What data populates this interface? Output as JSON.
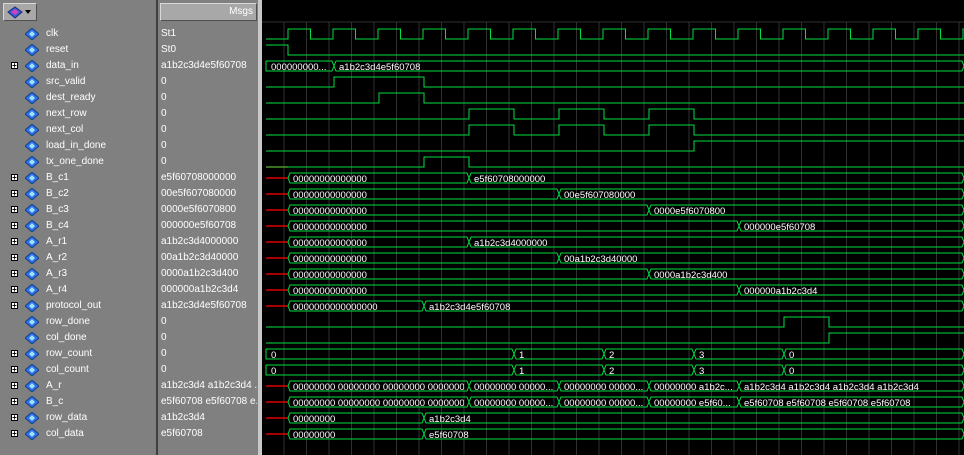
{
  "toolbar": {
    "icon": "signal-wave-icon",
    "dropdown_icon": "chevron-down-icon"
  },
  "header": {
    "msgs_label": "Msgs"
  },
  "colors": {
    "wave": "#00e040",
    "uninit": "#e00000",
    "grid": "#303030",
    "bg": "#000000",
    "panel": "#808080"
  },
  "signals": [
    {
      "name": "clk",
      "value": "St1",
      "expandable": false,
      "kind": "bit"
    },
    {
      "name": "reset",
      "value": "St0",
      "expandable": false,
      "kind": "bit"
    },
    {
      "name": "data_in",
      "value": "a1b2c3d4e5f60708",
      "expandable": true,
      "kind": "bus"
    },
    {
      "name": "src_valid",
      "value": "0",
      "expandable": false,
      "kind": "bit"
    },
    {
      "name": "dest_ready",
      "value": "0",
      "expandable": false,
      "kind": "bit"
    },
    {
      "name": "next_row",
      "value": "0",
      "expandable": false,
      "kind": "bit"
    },
    {
      "name": "next_col",
      "value": "0",
      "expandable": false,
      "kind": "bit"
    },
    {
      "name": "load_in_done",
      "value": "0",
      "expandable": false,
      "kind": "bit"
    },
    {
      "name": "tx_one_done",
      "value": "0",
      "expandable": false,
      "kind": "bit"
    },
    {
      "name": "B_c1",
      "value": "e5f60708000000",
      "expandable": true,
      "kind": "bus"
    },
    {
      "name": "B_c2",
      "value": "00e5f607080000",
      "expandable": true,
      "kind": "bus"
    },
    {
      "name": "B_c3",
      "value": "0000e5f6070800",
      "expandable": true,
      "kind": "bus"
    },
    {
      "name": "B_c4",
      "value": "000000e5f60708",
      "expandable": true,
      "kind": "bus"
    },
    {
      "name": "A_r1",
      "value": "a1b2c3d4000000",
      "expandable": true,
      "kind": "bus"
    },
    {
      "name": "A_r2",
      "value": "00a1b2c3d40000",
      "expandable": true,
      "kind": "bus"
    },
    {
      "name": "A_r3",
      "value": "0000a1b2c3d400",
      "expandable": true,
      "kind": "bus"
    },
    {
      "name": "A_r4",
      "value": "000000a1b2c3d4",
      "expandable": true,
      "kind": "bus"
    },
    {
      "name": "protocol_out",
      "value": "a1b2c3d4e5f60708",
      "expandable": true,
      "kind": "bus"
    },
    {
      "name": "row_done",
      "value": "0",
      "expandable": false,
      "kind": "bit"
    },
    {
      "name": "col_done",
      "value": "0",
      "expandable": false,
      "kind": "bit"
    },
    {
      "name": "row_count",
      "value": "0",
      "expandable": true,
      "kind": "bus"
    },
    {
      "name": "col_count",
      "value": "0",
      "expandable": true,
      "kind": "bus"
    },
    {
      "name": "A_r",
      "value": "a1b2c3d4 a1b2c3d4 ...",
      "expandable": true,
      "kind": "bus"
    },
    {
      "name": "B_c",
      "value": "e5f60708 e5f60708 e...",
      "expandable": true,
      "kind": "bus"
    },
    {
      "name": "row_data",
      "value": "a1b2c3d4",
      "expandable": true,
      "kind": "bus"
    },
    {
      "name": "col_data",
      "value": "e5f60708",
      "expandable": true,
      "kind": "bus"
    }
  ],
  "waves": {
    "clk": {
      "type": "clock"
    },
    "reset": {
      "type": "bit",
      "initial": 1,
      "edges": [
        22
      ],
      "red_until": 0
    },
    "data_in": {
      "type": "bus",
      "red_until": 0,
      "segments": [
        {
          "start": 0,
          "label": "000000000..."
        },
        {
          "start": 68,
          "label": "a1b2c3d4e5f60708"
        }
      ]
    },
    "src_valid": {
      "type": "bit",
      "initial": 0,
      "edges": [
        68,
        158
      ],
      "red_until": 0
    },
    "dest_ready": {
      "type": "bit",
      "initial": 0,
      "edges": [
        113,
        158
      ],
      "red_until": 0
    },
    "next_row": {
      "type": "bit",
      "initial": 0,
      "edges": [
        203,
        248,
        293,
        338,
        383,
        428
      ],
      "red_until": 0
    },
    "next_col": {
      "type": "bit",
      "initial": 0,
      "edges": [
        203,
        248,
        293,
        338,
        383,
        428
      ],
      "red_until": 0
    },
    "load_in_done": {
      "type": "bit",
      "initial": 0,
      "edges": [
        428
      ],
      "red_until": 0
    },
    "tx_one_done": {
      "type": "bit",
      "initial": 0,
      "edges": [
        158,
        203
      ],
      "red_until": 22
    },
    "B_c1": {
      "type": "bus",
      "red_until": 22,
      "segments": [
        {
          "start": 22,
          "label": "00000000000000"
        },
        {
          "start": 203,
          "label": "e5f60708000000"
        }
      ]
    },
    "B_c2": {
      "type": "bus",
      "red_until": 22,
      "segments": [
        {
          "start": 22,
          "label": "00000000000000"
        },
        {
          "start": 293,
          "label": "00e5f607080000"
        }
      ]
    },
    "B_c3": {
      "type": "bus",
      "red_until": 22,
      "segments": [
        {
          "start": 22,
          "label": "00000000000000"
        },
        {
          "start": 383,
          "label": "0000e5f6070800"
        }
      ]
    },
    "B_c4": {
      "type": "bus",
      "red_until": 22,
      "segments": [
        {
          "start": 22,
          "label": "00000000000000"
        },
        {
          "start": 473,
          "label": "000000e5f60708"
        }
      ]
    },
    "A_r1": {
      "type": "bus",
      "red_until": 22,
      "segments": [
        {
          "start": 22,
          "label": "00000000000000"
        },
        {
          "start": 203,
          "label": "a1b2c3d4000000"
        }
      ]
    },
    "A_r2": {
      "type": "bus",
      "red_until": 22,
      "segments": [
        {
          "start": 22,
          "label": "00000000000000"
        },
        {
          "start": 293,
          "label": "00a1b2c3d40000"
        }
      ]
    },
    "A_r3": {
      "type": "bus",
      "red_until": 22,
      "segments": [
        {
          "start": 22,
          "label": "00000000000000"
        },
        {
          "start": 383,
          "label": "0000a1b2c3d400"
        }
      ]
    },
    "A_r4": {
      "type": "bus",
      "red_until": 22,
      "segments": [
        {
          "start": 22,
          "label": "00000000000000"
        },
        {
          "start": 473,
          "label": "000000a1b2c3d4"
        }
      ]
    },
    "protocol_out": {
      "type": "bus",
      "red_until": 22,
      "segments": [
        {
          "start": 22,
          "label": "0000000000000000"
        },
        {
          "start": 158,
          "label": "a1b2c3d4e5f60708"
        }
      ]
    },
    "row_done": {
      "type": "bit",
      "initial": 0,
      "edges": [
        518,
        563
      ],
      "red_until": 0
    },
    "col_done": {
      "type": "bit",
      "initial": 0,
      "edges": [
        563
      ],
      "red_until": 0
    },
    "row_count": {
      "type": "bus",
      "red_until": 0,
      "segments": [
        {
          "start": 0,
          "label": "0"
        },
        {
          "start": 248,
          "label": "1"
        },
        {
          "start": 338,
          "label": "2"
        },
        {
          "start": 428,
          "label": "3"
        },
        {
          "start": 518,
          "label": "0"
        }
      ]
    },
    "col_count": {
      "type": "bus",
      "red_until": 0,
      "segments": [
        {
          "start": 0,
          "label": "0"
        },
        {
          "start": 248,
          "label": "1"
        },
        {
          "start": 338,
          "label": "2"
        },
        {
          "start": 428,
          "label": "3"
        },
        {
          "start": 518,
          "label": "0"
        }
      ]
    },
    "A_r": {
      "type": "bus",
      "red_until": 22,
      "segments": [
        {
          "start": 22,
          "label": "00000000 00000000 00000000 00000000"
        },
        {
          "start": 203,
          "label": "00000000 00000..."
        },
        {
          "start": 293,
          "label": "00000000 00000..."
        },
        {
          "start": 383,
          "label": "00000000 a1b2c..."
        },
        {
          "start": 473,
          "label": "a1b2c3d4 a1b2c3d4 a1b2c3d4 a1b2c3d4"
        }
      ]
    },
    "B_c": {
      "type": "bus",
      "red_until": 22,
      "segments": [
        {
          "start": 22,
          "label": "00000000 00000000 00000000 00000000"
        },
        {
          "start": 203,
          "label": "00000000 00000..."
        },
        {
          "start": 293,
          "label": "00000000 00000..."
        },
        {
          "start": 383,
          "label": "00000000 e5f60..."
        },
        {
          "start": 473,
          "label": "e5f60708 e5f60708 e5f60708 e5f60708"
        }
      ]
    },
    "row_data": {
      "type": "bus",
      "red_until": 22,
      "segments": [
        {
          "start": 22,
          "label": "00000000"
        },
        {
          "start": 158,
          "label": "a1b2c3d4"
        }
      ]
    },
    "col_data": {
      "type": "bus",
      "red_until": 22,
      "segments": [
        {
          "start": 22,
          "label": "00000000"
        },
        {
          "start": 158,
          "label": "e5f60708"
        }
      ]
    }
  }
}
